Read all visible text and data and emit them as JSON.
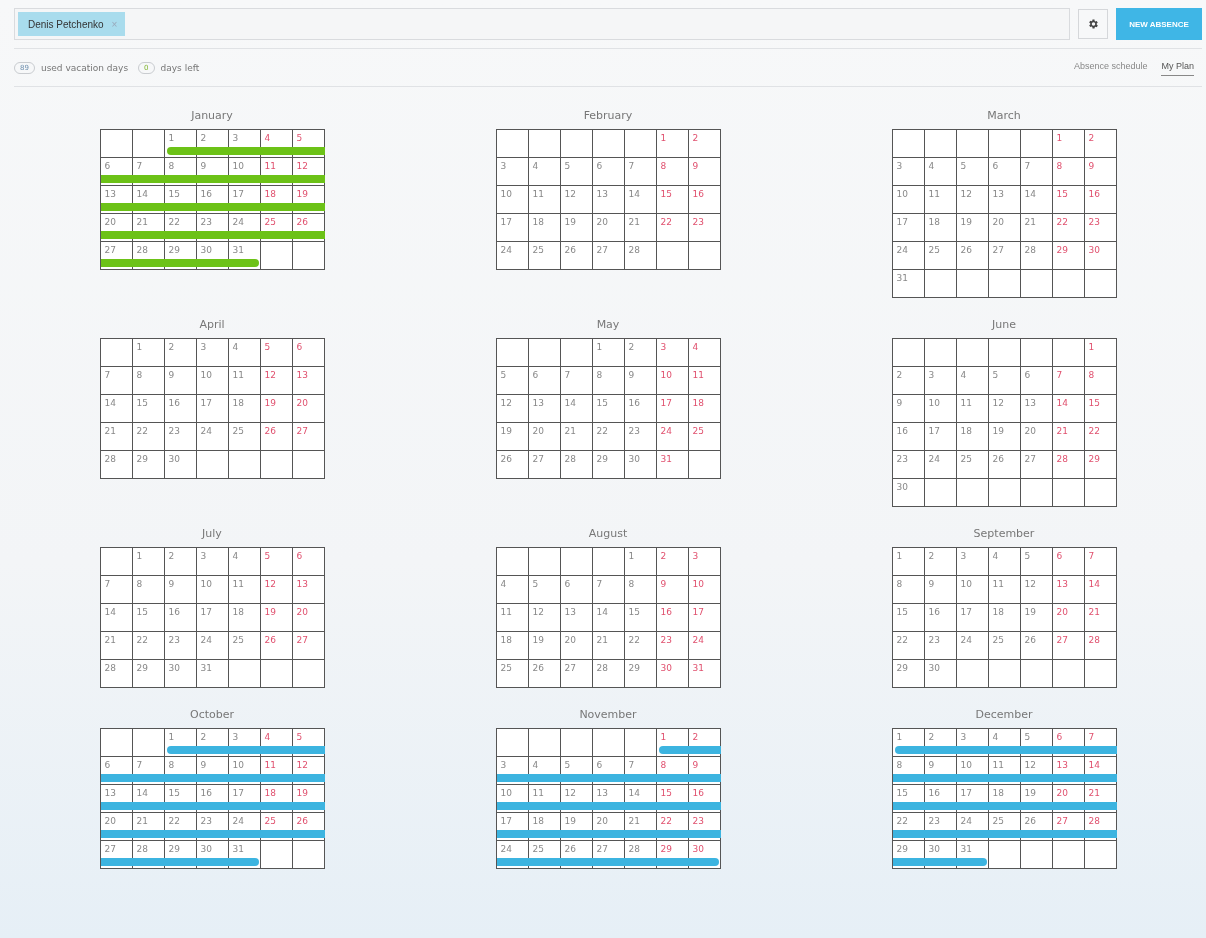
{
  "filter": {
    "chips": [
      {
        "label": "Denis Petchenko",
        "remove": "×"
      }
    ]
  },
  "actions": {
    "new_button": "NEW ABSENCE"
  },
  "summary": [
    {
      "count": "89",
      "label": "used vacation days",
      "kind": "used"
    },
    {
      "count": "0",
      "label": "days left",
      "kind": "left"
    }
  ],
  "view_tabs": [
    {
      "label": "Absence schedule",
      "selected": false
    },
    {
      "label": "My Plan",
      "selected": true
    }
  ],
  "months": [
    {
      "name": "January",
      "color": "#6cc217",
      "days": [
        {
          "day": "1",
          "weekend": false
        },
        {
          "day": "2",
          "weekend": false
        },
        {
          "day": "3",
          "weekend": false
        },
        {
          "day": "4",
          "weekend": true
        },
        {
          "day": "5",
          "weekend": true
        },
        {
          "day": "6",
          "weekend": false
        },
        {
          "day": "7",
          "weekend": false
        },
        {
          "day": "8",
          "weekend": false
        },
        {
          "day": "9",
          "weekend": false
        },
        {
          "day": "10",
          "weekend": false
        },
        {
          "day": "11",
          "weekend": true
        },
        {
          "day": "12",
          "weekend": true
        },
        {
          "day": "13",
          "weekend": false
        },
        {
          "day": "14",
          "weekend": false
        },
        {
          "day": "15",
          "weekend": false
        },
        {
          "day": "16",
          "weekend": false
        },
        {
          "day": "17",
          "weekend": false
        },
        {
          "day": "18",
          "weekend": true
        },
        {
          "day": "19",
          "weekend": true
        },
        {
          "day": "20",
          "weekend": false
        },
        {
          "day": "21",
          "weekend": false
        },
        {
          "day": "22",
          "weekend": false
        },
        {
          "day": "23",
          "weekend": false
        },
        {
          "day": "24",
          "weekend": false
        },
        {
          "day": "25",
          "weekend": true
        },
        {
          "day": "26",
          "weekend": true
        },
        {
          "day": "27",
          "weekend": false
        },
        {
          "day": "28",
          "weekend": false
        },
        {
          "day": "29",
          "weekend": false
        },
        {
          "day": "30",
          "weekend": false
        },
        {
          "day": "31",
          "weekend": false
        }
      ]
    },
    {
      "name": "February",
      "days": [
        {
          "day": "1",
          "weekend": true
        },
        {
          "day": "2",
          "weekend": true
        },
        {
          "day": "3",
          "weekend": false
        },
        {
          "day": "4",
          "weekend": false
        },
        {
          "day": "5",
          "weekend": false
        },
        {
          "day": "6",
          "weekend": false
        },
        {
          "day": "7",
          "weekend": false
        },
        {
          "day": "8",
          "weekend": true
        },
        {
          "day": "9",
          "weekend": true
        },
        {
          "day": "10",
          "weekend": false
        },
        {
          "day": "11",
          "weekend": false
        },
        {
          "day": "12",
          "weekend": false
        },
        {
          "day": "13",
          "weekend": false
        },
        {
          "day": "14",
          "weekend": false
        },
        {
          "day": "15",
          "weekend": true
        },
        {
          "day": "16",
          "weekend": true
        },
        {
          "day": "17",
          "weekend": false
        },
        {
          "day": "18",
          "weekend": false
        },
        {
          "day": "19",
          "weekend": false
        },
        {
          "day": "20",
          "weekend": false
        },
        {
          "day": "21",
          "weekend": false
        },
        {
          "day": "22",
          "weekend": true
        },
        {
          "day": "23",
          "weekend": true
        },
        {
          "day": "24",
          "weekend": false
        },
        {
          "day": "25",
          "weekend": false
        },
        {
          "day": "26",
          "weekend": false
        },
        {
          "day": "27",
          "weekend": false
        },
        {
          "day": "28",
          "weekend": false
        }
      ]
    },
    {
      "name": "March",
      "days": [
        {
          "day": "1",
          "weekend": true
        },
        {
          "day": "2",
          "weekend": true
        },
        {
          "day": "3",
          "weekend": false
        },
        {
          "day": "4",
          "weekend": false
        },
        {
          "day": "5",
          "weekend": false
        },
        {
          "day": "6",
          "weekend": false
        },
        {
          "day": "7",
          "weekend": false
        },
        {
          "day": "8",
          "weekend": true
        },
        {
          "day": "9",
          "weekend": true
        },
        {
          "day": "10",
          "weekend": false
        },
        {
          "day": "11",
          "weekend": false
        },
        {
          "day": "12",
          "weekend": false
        },
        {
          "day": "13",
          "weekend": false
        },
        {
          "day": "14",
          "weekend": false
        },
        {
          "day": "15",
          "weekend": true
        },
        {
          "day": "16",
          "weekend": true
        },
        {
          "day": "17",
          "weekend": false
        },
        {
          "day": "18",
          "weekend": false
        },
        {
          "day": "19",
          "weekend": false
        },
        {
          "day": "20",
          "weekend": false
        },
        {
          "day": "21",
          "weekend": false
        },
        {
          "day": "22",
          "weekend": true
        },
        {
          "day": "23",
          "weekend": true
        },
        {
          "day": "24",
          "weekend": false
        },
        {
          "day": "25",
          "weekend": false
        },
        {
          "day": "26",
          "weekend": false
        },
        {
          "day": "27",
          "weekend": false
        },
        {
          "day": "28",
          "weekend": false
        },
        {
          "day": "29",
          "weekend": true
        },
        {
          "day": "30",
          "weekend": true
        },
        {
          "day": "31",
          "weekend": false
        }
      ]
    },
    {
      "name": "April",
      "days": [
        {
          "day": "1",
          "weekend": false
        },
        {
          "day": "2",
          "weekend": false
        },
        {
          "day": "3",
          "weekend": false
        },
        {
          "day": "4",
          "weekend": false
        },
        {
          "day": "5",
          "weekend": true
        },
        {
          "day": "6",
          "weekend": true
        },
        {
          "day": "7",
          "weekend": false
        },
        {
          "day": "8",
          "weekend": false
        },
        {
          "day": "9",
          "weekend": false
        },
        {
          "day": "10",
          "weekend": false
        },
        {
          "day": "11",
          "weekend": false
        },
        {
          "day": "12",
          "weekend": true
        },
        {
          "day": "13",
          "weekend": true
        },
        {
          "day": "14",
          "weekend": false
        },
        {
          "day": "15",
          "weekend": false
        },
        {
          "day": "16",
          "weekend": false
        },
        {
          "day": "17",
          "weekend": false
        },
        {
          "day": "18",
          "weekend": false
        },
        {
          "day": "19",
          "weekend": true
        },
        {
          "day": "20",
          "weekend": true
        },
        {
          "day": "21",
          "weekend": false
        },
        {
          "day": "22",
          "weekend": false
        },
        {
          "day": "23",
          "weekend": false
        },
        {
          "day": "24",
          "weekend": false
        },
        {
          "day": "25",
          "weekend": false
        },
        {
          "day": "26",
          "weekend": true
        },
        {
          "day": "27",
          "weekend": true
        },
        {
          "day": "28",
          "weekend": false
        },
        {
          "day": "29",
          "weekend": false
        },
        {
          "day": "30",
          "weekend": false
        }
      ]
    },
    {
      "name": "May",
      "days": [
        {
          "day": "1",
          "weekend": false
        },
        {
          "day": "2",
          "weekend": false
        },
        {
          "day": "3",
          "weekend": true
        },
        {
          "day": "4",
          "weekend": true
        },
        {
          "day": "5",
          "weekend": false
        },
        {
          "day": "6",
          "weekend": false
        },
        {
          "day": "7",
          "weekend": false
        },
        {
          "day": "8",
          "weekend": false
        },
        {
          "day": "9",
          "weekend": false
        },
        {
          "day": "10",
          "weekend": true
        },
        {
          "day": "11",
          "weekend": true
        },
        {
          "day": "12",
          "weekend": false
        },
        {
          "day": "13",
          "weekend": false
        },
        {
          "day": "14",
          "weekend": false
        },
        {
          "day": "15",
          "weekend": false
        },
        {
          "day": "16",
          "weekend": false
        },
        {
          "day": "17",
          "weekend": true
        },
        {
          "day": "18",
          "weekend": true
        },
        {
          "day": "19",
          "weekend": false
        },
        {
          "day": "20",
          "weekend": false
        },
        {
          "day": "21",
          "weekend": false
        },
        {
          "day": "22",
          "weekend": false
        },
        {
          "day": "23",
          "weekend": false
        },
        {
          "day": "24",
          "weekend": true
        },
        {
          "day": "25",
          "weekend": true
        },
        {
          "day": "26",
          "weekend": false
        },
        {
          "day": "27",
          "weekend": false
        },
        {
          "day": "28",
          "weekend": false
        },
        {
          "day": "29",
          "weekend": false
        },
        {
          "day": "30",
          "weekend": false
        },
        {
          "day": "31",
          "weekend": true
        }
      ]
    },
    {
      "name": "June",
      "days": [
        {
          "day": "1",
          "weekend": true
        },
        {
          "day": "2",
          "weekend": false
        },
        {
          "day": "3",
          "weekend": false
        },
        {
          "day": "4",
          "weekend": false
        },
        {
          "day": "5",
          "weekend": false
        },
        {
          "day": "6",
          "weekend": false
        },
        {
          "day": "7",
          "weekend": true
        },
        {
          "day": "8",
          "weekend": true
        },
        {
          "day": "9",
          "weekend": false
        },
        {
          "day": "10",
          "weekend": false
        },
        {
          "day": "11",
          "weekend": false
        },
        {
          "day": "12",
          "weekend": false
        },
        {
          "day": "13",
          "weekend": false
        },
        {
          "day": "14",
          "weekend": true
        },
        {
          "day": "15",
          "weekend": true
        },
        {
          "day": "16",
          "weekend": false
        },
        {
          "day": "17",
          "weekend": false
        },
        {
          "day": "18",
          "weekend": false
        },
        {
          "day": "19",
          "weekend": false
        },
        {
          "day": "20",
          "weekend": false
        },
        {
          "day": "21",
          "weekend": true
        },
        {
          "day": "22",
          "weekend": true
        },
        {
          "day": "23",
          "weekend": false
        },
        {
          "day": "24",
          "weekend": false
        },
        {
          "day": "25",
          "weekend": false
        },
        {
          "day": "26",
          "weekend": false
        },
        {
          "day": "27",
          "weekend": false
        },
        {
          "day": "28",
          "weekend": true
        },
        {
          "day": "29",
          "weekend": true
        },
        {
          "day": "30",
          "weekend": false
        }
      ]
    },
    {
      "name": "July",
      "days": [
        {
          "day": "1",
          "weekend": false
        },
        {
          "day": "2",
          "weekend": false
        },
        {
          "day": "3",
          "weekend": false
        },
        {
          "day": "4",
          "weekend": false
        },
        {
          "day": "5",
          "weekend": true
        },
        {
          "day": "6",
          "weekend": true
        },
        {
          "day": "7",
          "weekend": false
        },
        {
          "day": "8",
          "weekend": false
        },
        {
          "day": "9",
          "weekend": false
        },
        {
          "day": "10",
          "weekend": false
        },
        {
          "day": "11",
          "weekend": false
        },
        {
          "day": "12",
          "weekend": true
        },
        {
          "day": "13",
          "weekend": true
        },
        {
          "day": "14",
          "weekend": false
        },
        {
          "day": "15",
          "weekend": false
        },
        {
          "day": "16",
          "weekend": false
        },
        {
          "day": "17",
          "weekend": false
        },
        {
          "day": "18",
          "weekend": false
        },
        {
          "day": "19",
          "weekend": true
        },
        {
          "day": "20",
          "weekend": true
        },
        {
          "day": "21",
          "weekend": false
        },
        {
          "day": "22",
          "weekend": false
        },
        {
          "day": "23",
          "weekend": false
        },
        {
          "day": "24",
          "weekend": false
        },
        {
          "day": "25",
          "weekend": false
        },
        {
          "day": "26",
          "weekend": true
        },
        {
          "day": "27",
          "weekend": true
        },
        {
          "day": "28",
          "weekend": false
        },
        {
          "day": "29",
          "weekend": false
        },
        {
          "day": "30",
          "weekend": false
        },
        {
          "day": "31",
          "weekend": false
        }
      ]
    },
    {
      "name": "August",
      "days": [
        {
          "day": "1",
          "weekend": false
        },
        {
          "day": "2",
          "weekend": true
        },
        {
          "day": "3",
          "weekend": true
        },
        {
          "day": "4",
          "weekend": false
        },
        {
          "day": "5",
          "weekend": false
        },
        {
          "day": "6",
          "weekend": false
        },
        {
          "day": "7",
          "weekend": false
        },
        {
          "day": "8",
          "weekend": false
        },
        {
          "day": "9",
          "weekend": true
        },
        {
          "day": "10",
          "weekend": true
        },
        {
          "day": "11",
          "weekend": false
        },
        {
          "day": "12",
          "weekend": false
        },
        {
          "day": "13",
          "weekend": false
        },
        {
          "day": "14",
          "weekend": false
        },
        {
          "day": "15",
          "weekend": false
        },
        {
          "day": "16",
          "weekend": true
        },
        {
          "day": "17",
          "weekend": true
        },
        {
          "day": "18",
          "weekend": false
        },
        {
          "day": "19",
          "weekend": false
        },
        {
          "day": "20",
          "weekend": false
        },
        {
          "day": "21",
          "weekend": false
        },
        {
          "day": "22",
          "weekend": false
        },
        {
          "day": "23",
          "weekend": true
        },
        {
          "day": "24",
          "weekend": true
        },
        {
          "day": "25",
          "weekend": false
        },
        {
          "day": "26",
          "weekend": false
        },
        {
          "day": "27",
          "weekend": false
        },
        {
          "day": "28",
          "weekend": false
        },
        {
          "day": "29",
          "weekend": false
        },
        {
          "day": "30",
          "weekend": true
        },
        {
          "day": "31",
          "weekend": true
        }
      ]
    },
    {
      "name": "September",
      "days": [
        {
          "day": "1",
          "weekend": false
        },
        {
          "day": "2",
          "weekend": false
        },
        {
          "day": "3",
          "weekend": false
        },
        {
          "day": "4",
          "weekend": false
        },
        {
          "day": "5",
          "weekend": false
        },
        {
          "day": "6",
          "weekend": true
        },
        {
          "day": "7",
          "weekend": true
        },
        {
          "day": "8",
          "weekend": false
        },
        {
          "day": "9",
          "weekend": false
        },
        {
          "day": "10",
          "weekend": false
        },
        {
          "day": "11",
          "weekend": false
        },
        {
          "day": "12",
          "weekend": false
        },
        {
          "day": "13",
          "weekend": true
        },
        {
          "day": "14",
          "weekend": true
        },
        {
          "day": "15",
          "weekend": false
        },
        {
          "day": "16",
          "weekend": false
        },
        {
          "day": "17",
          "weekend": false
        },
        {
          "day": "18",
          "weekend": false
        },
        {
          "day": "19",
          "weekend": false
        },
        {
          "day": "20",
          "weekend": true
        },
        {
          "day": "21",
          "weekend": true
        },
        {
          "day": "22",
          "weekend": false
        },
        {
          "day": "23",
          "weekend": false
        },
        {
          "day": "24",
          "weekend": false
        },
        {
          "day": "25",
          "weekend": false
        },
        {
          "day": "26",
          "weekend": false
        },
        {
          "day": "27",
          "weekend": true
        },
        {
          "day": "28",
          "weekend": true
        },
        {
          "day": "29",
          "weekend": false
        },
        {
          "day": "30",
          "weekend": false
        }
      ]
    },
    {
      "name": "October",
      "color": "#3cb4e0",
      "days": [
        {
          "day": "1",
          "weekend": false
        },
        {
          "day": "2",
          "weekend": false
        },
        {
          "day": "3",
          "weekend": false
        },
        {
          "day": "4",
          "weekend": true
        },
        {
          "day": "5",
          "weekend": true
        },
        {
          "day": "6",
          "weekend": false
        },
        {
          "day": "7",
          "weekend": false
        },
        {
          "day": "8",
          "weekend": false
        },
        {
          "day": "9",
          "weekend": false
        },
        {
          "day": "10",
          "weekend": false
        },
        {
          "day": "11",
          "weekend": true
        },
        {
          "day": "12",
          "weekend": true
        },
        {
          "day": "13",
          "weekend": false
        },
        {
          "day": "14",
          "weekend": false
        },
        {
          "day": "15",
          "weekend": false
        },
        {
          "day": "16",
          "weekend": false
        },
        {
          "day": "17",
          "weekend": false
        },
        {
          "day": "18",
          "weekend": true
        },
        {
          "day": "19",
          "weekend": true
        },
        {
          "day": "20",
          "weekend": false
        },
        {
          "day": "21",
          "weekend": false
        },
        {
          "day": "22",
          "weekend": false
        },
        {
          "day": "23",
          "weekend": false
        },
        {
          "day": "24",
          "weekend": false
        },
        {
          "day": "25",
          "weekend": true
        },
        {
          "day": "26",
          "weekend": true
        },
        {
          "day": "27",
          "weekend": false
        },
        {
          "day": "28",
          "weekend": false
        },
        {
          "day": "29",
          "weekend": false
        },
        {
          "day": "30",
          "weekend": false
        },
        {
          "day": "31",
          "weekend": false
        }
      ]
    },
    {
      "name": "November",
      "color": "#3cb4e0",
      "days": [
        {
          "day": "1",
          "weekend": true
        },
        {
          "day": "2",
          "weekend": true
        },
        {
          "day": "3",
          "weekend": false
        },
        {
          "day": "4",
          "weekend": false
        },
        {
          "day": "5",
          "weekend": false
        },
        {
          "day": "6",
          "weekend": false
        },
        {
          "day": "7",
          "weekend": false
        },
        {
          "day": "8",
          "weekend": true
        },
        {
          "day": "9",
          "weekend": true
        },
        {
          "day": "10",
          "weekend": false
        },
        {
          "day": "11",
          "weekend": false
        },
        {
          "day": "12",
          "weekend": false
        },
        {
          "day": "13",
          "weekend": false
        },
        {
          "day": "14",
          "weekend": false
        },
        {
          "day": "15",
          "weekend": true
        },
        {
          "day": "16",
          "weekend": true
        },
        {
          "day": "17",
          "weekend": false
        },
        {
          "day": "18",
          "weekend": false
        },
        {
          "day": "19",
          "weekend": false
        },
        {
          "day": "20",
          "weekend": false
        },
        {
          "day": "21",
          "weekend": false
        },
        {
          "day": "22",
          "weekend": true
        },
        {
          "day": "23",
          "weekend": true
        },
        {
          "day": "24",
          "weekend": false
        },
        {
          "day": "25",
          "weekend": false
        },
        {
          "day": "26",
          "weekend": false
        },
        {
          "day": "27",
          "weekend": false
        },
        {
          "day": "28",
          "weekend": false
        },
        {
          "day": "29",
          "weekend": true
        },
        {
          "day": "30",
          "weekend": true
        }
      ]
    },
    {
      "name": "December",
      "color": "#3cb4e0",
      "days": [
        {
          "day": "1",
          "weekend": false
        },
        {
          "day": "2",
          "weekend": false
        },
        {
          "day": "3",
          "weekend": false
        },
        {
          "day": "4",
          "weekend": false
        },
        {
          "day": "5",
          "weekend": false
        },
        {
          "day": "6",
          "weekend": true
        },
        {
          "day": "7",
          "weekend": true
        },
        {
          "day": "8",
          "weekend": false
        },
        {
          "day": "9",
          "weekend": false
        },
        {
          "day": "10",
          "weekend": false
        },
        {
          "day": "11",
          "weekend": false
        },
        {
          "day": "12",
          "weekend": false
        },
        {
          "day": "13",
          "weekend": true
        },
        {
          "day": "14",
          "weekend": true
        },
        {
          "day": "15",
          "weekend": false
        },
        {
          "day": "16",
          "weekend": false
        },
        {
          "day": "17",
          "weekend": false
        },
        {
          "day": "18",
          "weekend": false
        },
        {
          "day": "19",
          "weekend": false
        },
        {
          "day": "20",
          "weekend": true
        },
        {
          "day": "21",
          "weekend": true
        },
        {
          "day": "22",
          "weekend": false
        },
        {
          "day": "23",
          "weekend": false
        },
        {
          "day": "24",
          "weekend": false
        },
        {
          "day": "25",
          "weekend": false
        },
        {
          "day": "26",
          "weekend": false
        },
        {
          "day": "27",
          "weekend": true
        },
        {
          "day": "28",
          "weekend": true
        },
        {
          "day": "29",
          "weekend": false
        },
        {
          "day": "30",
          "weekend": false
        },
        {
          "day": "31",
          "weekend": false
        }
      ]
    }
  ]
}
